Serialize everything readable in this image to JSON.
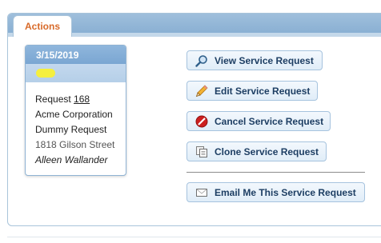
{
  "tab": {
    "label": "Actions"
  },
  "card": {
    "date": "3/15/2019",
    "request_prefix": "Request",
    "request_number": "168",
    "company": "Acme Corporation",
    "request_title": "Dummy Request",
    "address": "1818 Gilson Street",
    "person": "Alleen Wallander"
  },
  "buttons": {
    "view": "View Service Request",
    "edit": "Edit Service Request",
    "cancel": "Cancel Service Request",
    "clone": "Clone Service Request",
    "email": "Email Me This Service Request"
  },
  "icons": {
    "view": "magnifier-icon",
    "edit": "pencil-icon",
    "cancel": "cancel-icon",
    "clone": "copy-icon",
    "email": "envelope-icon"
  },
  "colors": {
    "tab_text": "#d86a2a",
    "header_blue": "#8ab0d3",
    "button_text": "#1d3e63",
    "highlight": "#f5ef3f"
  }
}
